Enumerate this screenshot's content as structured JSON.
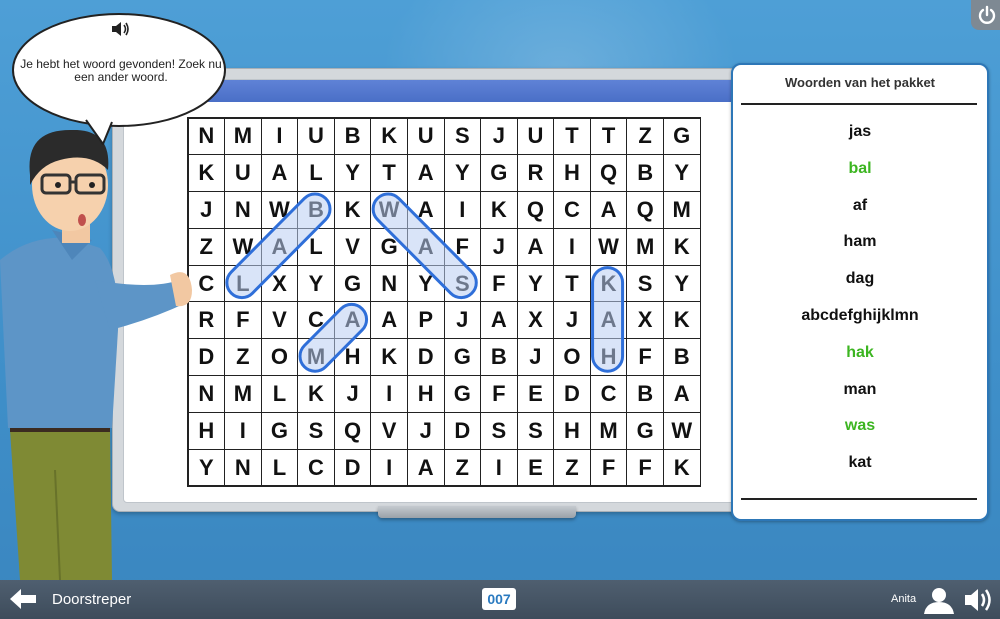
{
  "bubble": {
    "text": "Je hebt het woord gevonden! Zoek nu een ander woord.",
    "icon": "speaker-icon"
  },
  "grid": {
    "rows": [
      [
        "N",
        "M",
        "I",
        "U",
        "B",
        "K",
        "U",
        "S",
        "J",
        "U",
        "T",
        "T",
        "Z",
        "G"
      ],
      [
        "K",
        "U",
        "A",
        "L",
        "Y",
        "T",
        "A",
        "Y",
        "G",
        "R",
        "H",
        "Q",
        "B",
        "Y"
      ],
      [
        "J",
        "N",
        "W",
        "B",
        "K",
        "W",
        "A",
        "I",
        "K",
        "Q",
        "C",
        "A",
        "Q",
        "M"
      ],
      [
        "Z",
        "W",
        "A",
        "L",
        "V",
        "G",
        "A",
        "F",
        "J",
        "A",
        "I",
        "W",
        "M",
        "K"
      ],
      [
        "C",
        "L",
        "X",
        "Y",
        "G",
        "N",
        "Y",
        "S",
        "F",
        "Y",
        "T",
        "K",
        "S",
        "Y"
      ],
      [
        "R",
        "F",
        "V",
        "C",
        "A",
        "A",
        "P",
        "J",
        "A",
        "X",
        "J",
        "A",
        "X",
        "K"
      ],
      [
        "D",
        "Z",
        "O",
        "M",
        "H",
        "K",
        "D",
        "G",
        "B",
        "J",
        "O",
        "H",
        "F",
        "B"
      ],
      [
        "N",
        "M",
        "L",
        "K",
        "J",
        "I",
        "H",
        "G",
        "F",
        "E",
        "D",
        "C",
        "B",
        "A"
      ],
      [
        "H",
        "I",
        "G",
        "S",
        "Q",
        "V",
        "J",
        "D",
        "S",
        "S",
        "H",
        "M",
        "G",
        "W"
      ],
      [
        "Y",
        "N",
        "L",
        "C",
        "D",
        "I",
        "A",
        "Z",
        "I",
        "E",
        "Z",
        "F",
        "F",
        "K"
      ]
    ],
    "found_words": [
      {
        "word": "bal",
        "from": [
          2,
          3
        ],
        "to": [
          4,
          1
        ]
      },
      {
        "word": "was",
        "from": [
          2,
          5
        ],
        "to": [
          4,
          7
        ]
      },
      {
        "word": "ma",
        "from": [
          6,
          3
        ],
        "to": [
          5,
          4
        ]
      },
      {
        "word": "kah",
        "from": [
          4,
          11
        ],
        "to": [
          6,
          11
        ]
      }
    ]
  },
  "panel": {
    "title": "Woorden van het pakket",
    "words": [
      {
        "text": "jas",
        "found": false
      },
      {
        "text": "bal",
        "found": true
      },
      {
        "text": "af",
        "found": false
      },
      {
        "text": "ham",
        "found": false
      },
      {
        "text": "dag",
        "found": false
      },
      {
        "text": "abcdefghijklmn",
        "found": false
      },
      {
        "text": "hak",
        "found": true
      },
      {
        "text": "man",
        "found": false
      },
      {
        "text": "was",
        "found": true
      },
      {
        "text": "kat",
        "found": false
      }
    ],
    "found_color": "#3cb521"
  },
  "bottom_bar": {
    "app_name": "Doorstreper",
    "counter": "007",
    "user_name": "Anita",
    "icons": [
      "back-arrow-icon",
      "user-icon",
      "sound-icon",
      "power-icon"
    ]
  },
  "colors": {
    "background": "#4a9ad2",
    "highlight_fill": "#b9cdf3",
    "highlight_stroke": "#2f6fd9",
    "accent": "#2a7ac0"
  }
}
